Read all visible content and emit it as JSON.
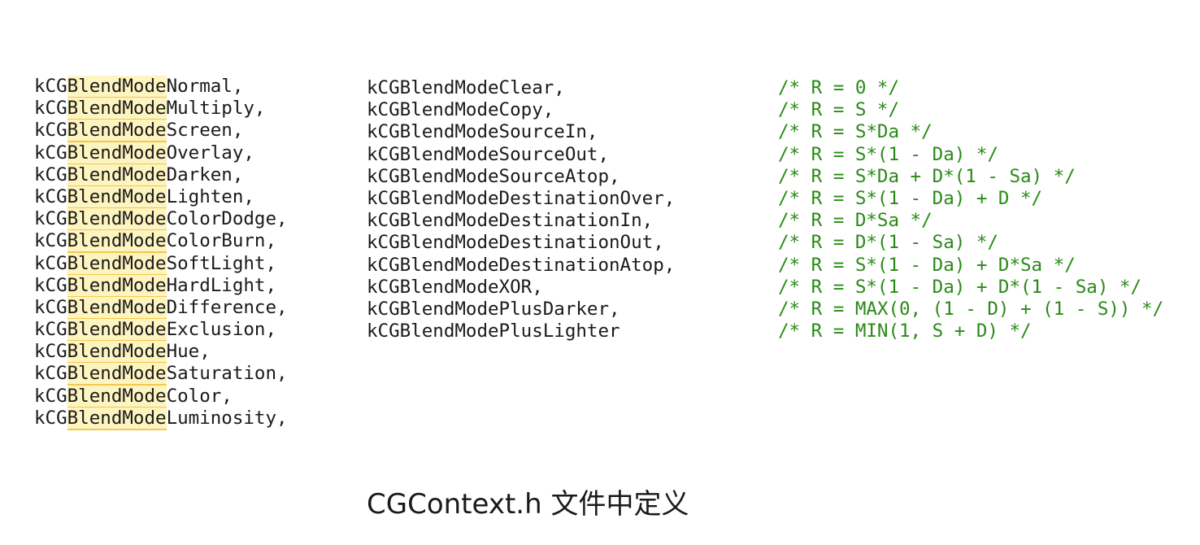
{
  "left_column": {
    "prefix": "kCG",
    "highlight": "BlendMode",
    "items": [
      "Normal,",
      "Multiply,",
      "Screen,",
      "Overlay,",
      "Darken,",
      "Lighten,",
      "ColorDodge,",
      "ColorBurn,",
      "SoftLight,",
      "HardLight,",
      "Difference,",
      "Exclusion,",
      "Hue,",
      "Saturation,",
      "Color,",
      "Luminosity,"
    ]
  },
  "middle_column": {
    "items": [
      "kCGBlendModeClear,",
      "kCGBlendModeCopy,",
      "kCGBlendModeSourceIn,",
      "kCGBlendModeSourceOut,",
      "kCGBlendModeSourceAtop,",
      "kCGBlendModeDestinationOver,",
      "kCGBlendModeDestinationIn,",
      "kCGBlendModeDestinationOut,",
      "kCGBlendModeDestinationAtop,",
      "kCGBlendModeXOR,",
      "kCGBlendModePlusDarker,",
      "kCGBlendModePlusLighter"
    ]
  },
  "comments_column": {
    "items": [
      "/* R = 0 */",
      "/* R = S */",
      "/* R = S*Da */",
      "/* R = S*(1 - Da) */",
      "/* R = S*Da + D*(1 - Sa) */",
      "/* R = S*(1 - Da) + D */",
      "/* R = D*Sa */",
      "/* R = D*(1 - Sa) */",
      "/* R = S*(1 - Da) + D*Sa */",
      "/* R = S*(1 - Da) + D*(1 - Sa) */",
      "/* R = MAX(0, (1 - D) + (1 - S)) */",
      "/* R = MIN(1, S + D) */"
    ]
  },
  "caption": "CGContext.h 文件中定义",
  "colors": {
    "text": "#1a1a1a",
    "comment": "#2a8a17",
    "highlight_bg": "#fdf4c0",
    "highlight_underline": "#f2c94c"
  }
}
